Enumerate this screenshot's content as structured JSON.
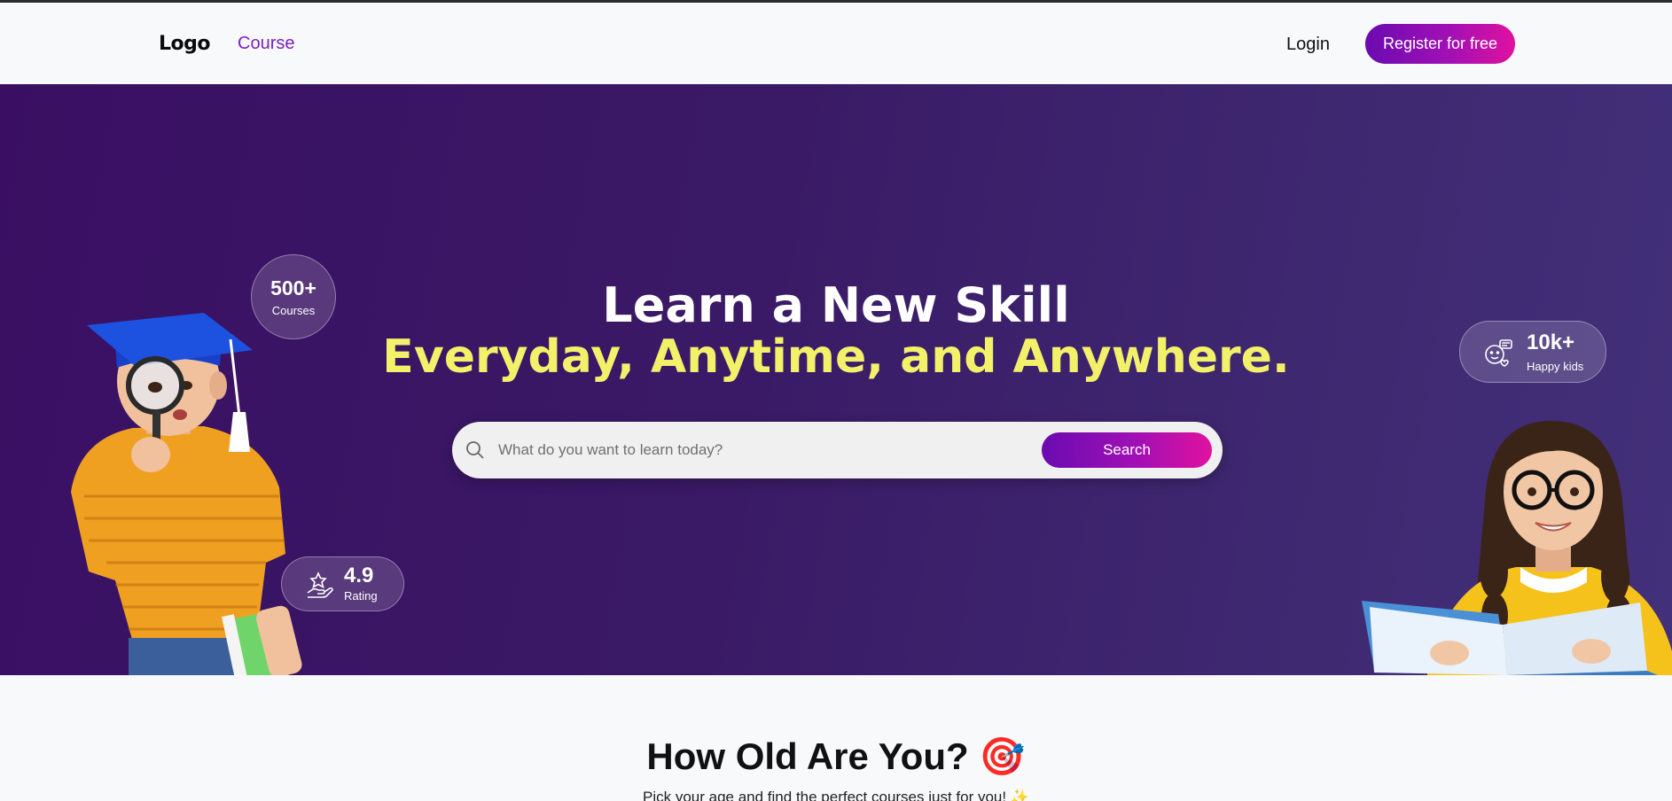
{
  "nav": {
    "logo": "Logo",
    "course": "Course",
    "login": "Login",
    "register": "Register for free"
  },
  "hero": {
    "title_line1": "Learn a New Skill",
    "title_line2": "Everyday, Anytime, and Anywhere.",
    "search": {
      "placeholder": "What do you want to learn today?",
      "button": "Search"
    },
    "stats": {
      "courses": {
        "value": "500+",
        "label": "Courses"
      },
      "kids": {
        "value": "10k+",
        "label": "Happy kids"
      },
      "rating": {
        "value": "4.9",
        "label": "Rating"
      }
    }
  },
  "age_section": {
    "title": "How Old Are You? 🎯",
    "subtitle": "Pick your age and find the perfect courses just for you! ✨"
  },
  "colors": {
    "accent_purple": "#7a1fc3",
    "gradient_start": "#6a0bb0",
    "gradient_end": "#e0119f",
    "hero_bg": "#3a1a66",
    "headline_yellow": "#f3f06a"
  }
}
